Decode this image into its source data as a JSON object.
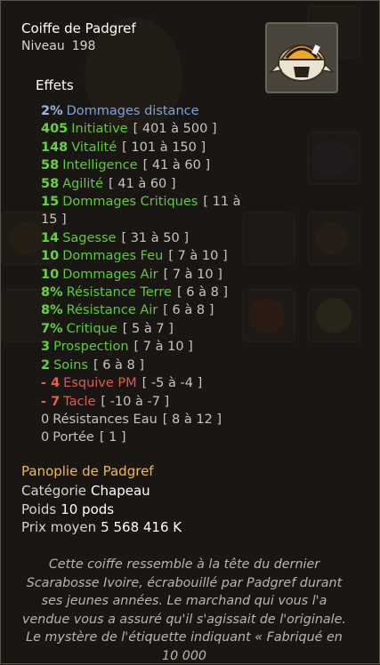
{
  "item": {
    "name": "Coiffe de Padgref",
    "level_label": "Niveau",
    "level_value": "198",
    "icon": "skull-helmet-icon"
  },
  "effects": {
    "title": "Effets",
    "list": [
      {
        "value": "2%",
        "stat": "Dommages distance",
        "range": "",
        "color": "blue"
      },
      {
        "value": "405",
        "stat": "Initiative",
        "range": "[ 401 à 500 ]",
        "color": "green"
      },
      {
        "value": "148",
        "stat": "Vitalité",
        "range": "[ 101 à 150 ]",
        "color": "green"
      },
      {
        "value": "58",
        "stat": "Intelligence",
        "range": "[ 41 à 60 ]",
        "color": "green"
      },
      {
        "value": "58",
        "stat": "Agilité",
        "range": "[ 41 à 60 ]",
        "color": "green"
      },
      {
        "value": "15",
        "stat": "Dommages Critiques",
        "range": "[ 11 à 15 ]",
        "color": "green"
      },
      {
        "value": "14",
        "stat": "Sagesse",
        "range": "[ 31 à 50 ]",
        "color": "green"
      },
      {
        "value": "10",
        "stat": "Dommages Feu",
        "range": "[ 7 à 10 ]",
        "color": "green"
      },
      {
        "value": "10",
        "stat": "Dommages Air",
        "range": "[ 7 à 10 ]",
        "color": "green"
      },
      {
        "value": "8%",
        "stat": "Résistance Terre",
        "range": "[ 6 à 8 ]",
        "color": "green"
      },
      {
        "value": "8%",
        "stat": "Résistance Air",
        "range": "[ 6 à 8 ]",
        "color": "green"
      },
      {
        "value": "7%",
        "stat": "Critique",
        "range": "[ 5 à 7 ]",
        "color": "green"
      },
      {
        "value": "3",
        "stat": "Prospection",
        "range": "[ 7 à 10 ]",
        "color": "green"
      },
      {
        "value": "2",
        "stat": "Soins",
        "range": "[ 6 à 8 ]",
        "color": "green"
      },
      {
        "value": "- 4",
        "stat": "Esquive PM",
        "range": "[ -5 à -4 ]",
        "color": "red"
      },
      {
        "value": "- 7",
        "stat": "Tacle",
        "range": "[ -10 à -7 ]",
        "color": "red"
      },
      {
        "value": "0",
        "stat": "Résistances Eau",
        "range": "[ 8 à 12 ]",
        "color": "grey"
      },
      {
        "value": "0",
        "stat": "Portée",
        "range": "[ 1 ]",
        "color": "grey"
      }
    ]
  },
  "set": {
    "name": "Panoplie de Padgref"
  },
  "info": {
    "category_label": "Catégorie",
    "category_value": "Chapeau",
    "weight_label": "Poids",
    "weight_value": "10 pods",
    "price_label": "Prix moyen",
    "price_value": "5 568 416 K"
  },
  "description": "Cette coiffe ressemble à la tête du dernier Scarabosse Ivoire, écrabouillé par Padgref durant ses jeunes années. Le marchand qui vous l'a vendue vous a assuré qu'il s'agissait de l'originale. Le mystère de l'étiquette indiquant « Fabriqué en 10 000",
  "colors": {
    "blue": "#7ea3d6",
    "green": "#5fcb37",
    "red": "#e15a4b",
    "grey": "#c8c4bc",
    "set": "#f0b94a"
  }
}
